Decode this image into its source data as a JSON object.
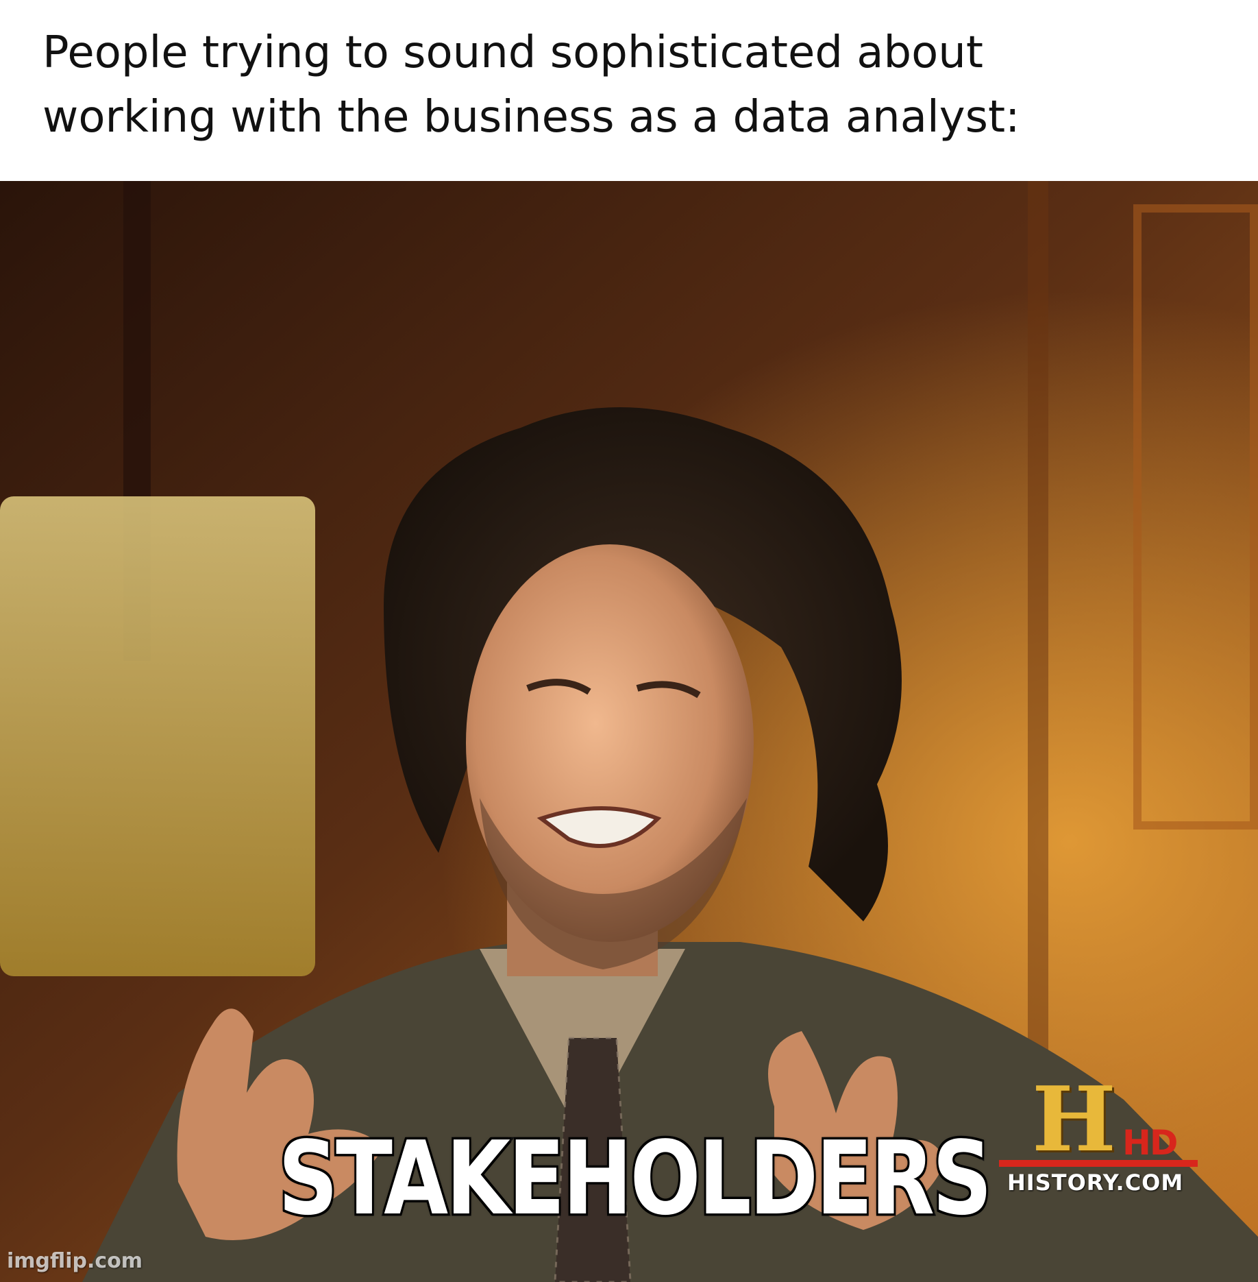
{
  "caption": {
    "line1": "People trying to sound sophisticated about",
    "line2": "working with the business as a data analyst:"
  },
  "meme": {
    "impact_text": "STAKEHOLDERS",
    "logo": {
      "letter": "H",
      "badge": "HD",
      "site": "HISTORY.COM"
    },
    "watermark": "imgflip.com"
  },
  "colors": {
    "background_dark": "#3a1e10",
    "wall_warm": "#c8822a",
    "suit": "#4a4536",
    "logo_gold": "#e8b83a",
    "logo_red": "#d8261c"
  }
}
